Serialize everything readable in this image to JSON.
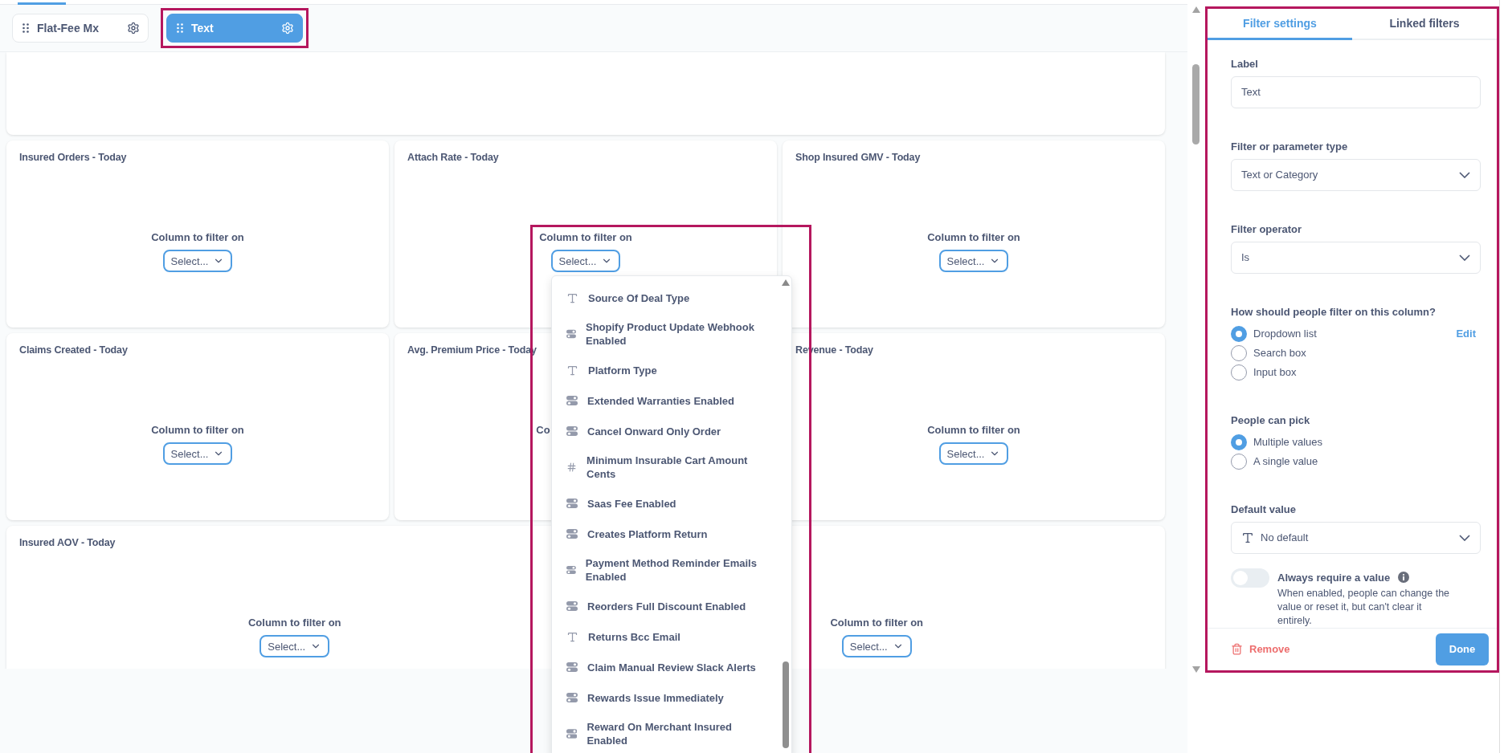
{
  "filter_chips": [
    {
      "label": "Flat-Fee Mx",
      "selected": false,
      "highlighted": false
    },
    {
      "label": "Text",
      "selected": true,
      "highlighted": true
    }
  ],
  "card_rows": [
    [
      {
        "title": "Insured Orders - Today",
        "filter_label": "Column to filter on",
        "select_placeholder": "Select..."
      },
      {
        "title": "Attach Rate - Today",
        "filter_label": "Column to filter on",
        "select_placeholder": "Select..."
      },
      {
        "title": "Shop Insured GMV - Today",
        "filter_label": "Column to filter on",
        "select_placeholder": "Select..."
      }
    ],
    [
      {
        "title": "Claims Created - Today",
        "filter_label": "Column to filter on",
        "select_placeholder": "Select..."
      },
      {
        "title": "Avg. Premium Price - Today",
        "filter_label": "Co"
      },
      {
        "title": "Revenue - Today",
        "filter_label": "Column to filter on",
        "select_placeholder": "Select..."
      }
    ],
    [
      {
        "title": "Insured AOV - Today",
        "filter_label": "Column to filter on",
        "select_placeholder": "Select..."
      },
      {
        "filter_label": "Column to filter on",
        "select_placeholder": "Select..."
      }
    ]
  ],
  "column_dropdown": {
    "highlighted": true,
    "items": [
      {
        "label": "Source Of Deal Type",
        "kind": "text"
      },
      {
        "label": "Shopify Product Update Webhook Enabled",
        "kind": "boolean"
      },
      {
        "label": "Platform Type",
        "kind": "text"
      },
      {
        "label": "Extended Warranties Enabled",
        "kind": "boolean"
      },
      {
        "label": "Cancel Onward Only Order",
        "kind": "boolean"
      },
      {
        "label": "Minimum Insurable Cart Amount Cents",
        "kind": "number"
      },
      {
        "label": "Saas Fee Enabled",
        "kind": "boolean"
      },
      {
        "label": "Creates Platform Return",
        "kind": "boolean"
      },
      {
        "label": "Payment Method Reminder Emails Enabled",
        "kind": "boolean"
      },
      {
        "label": "Reorders Full Discount Enabled",
        "kind": "boolean"
      },
      {
        "label": "Returns Bcc Email",
        "kind": "text"
      },
      {
        "label": "Claim Manual Review Slack Alerts",
        "kind": "boolean"
      },
      {
        "label": "Rewards Issue Immediately",
        "kind": "boolean"
      },
      {
        "label": "Reward On Merchant Insured Enabled",
        "kind": "boolean"
      }
    ]
  },
  "settings_panel": {
    "highlighted": true,
    "tabs": [
      {
        "label": "Filter settings",
        "selected": true
      },
      {
        "label": "Linked filters",
        "selected": false
      }
    ],
    "label": {
      "title": "Label",
      "value": "Text"
    },
    "type": {
      "title": "Filter or parameter type",
      "value": "Text or Category"
    },
    "operator": {
      "title": "Filter operator",
      "value": "Is"
    },
    "filter_mode": {
      "title": "How should people filter on this column?",
      "edit_link": "Edit",
      "options": [
        {
          "label": "Dropdown list",
          "selected": true
        },
        {
          "label": "Search box",
          "selected": false
        },
        {
          "label": "Input box",
          "selected": false
        }
      ]
    },
    "pick": {
      "title": "People can pick",
      "options": [
        {
          "label": "Multiple values",
          "selected": true
        },
        {
          "label": "A single value",
          "selected": false
        }
      ]
    },
    "default_value": {
      "title": "Default value",
      "value": "No default"
    },
    "require_value": {
      "label": "Always require a value",
      "on": false,
      "description": "When enabled, people can change the value or reset it, but can't clear it entirely."
    },
    "remove_button": "Remove",
    "done_button": "Done"
  }
}
